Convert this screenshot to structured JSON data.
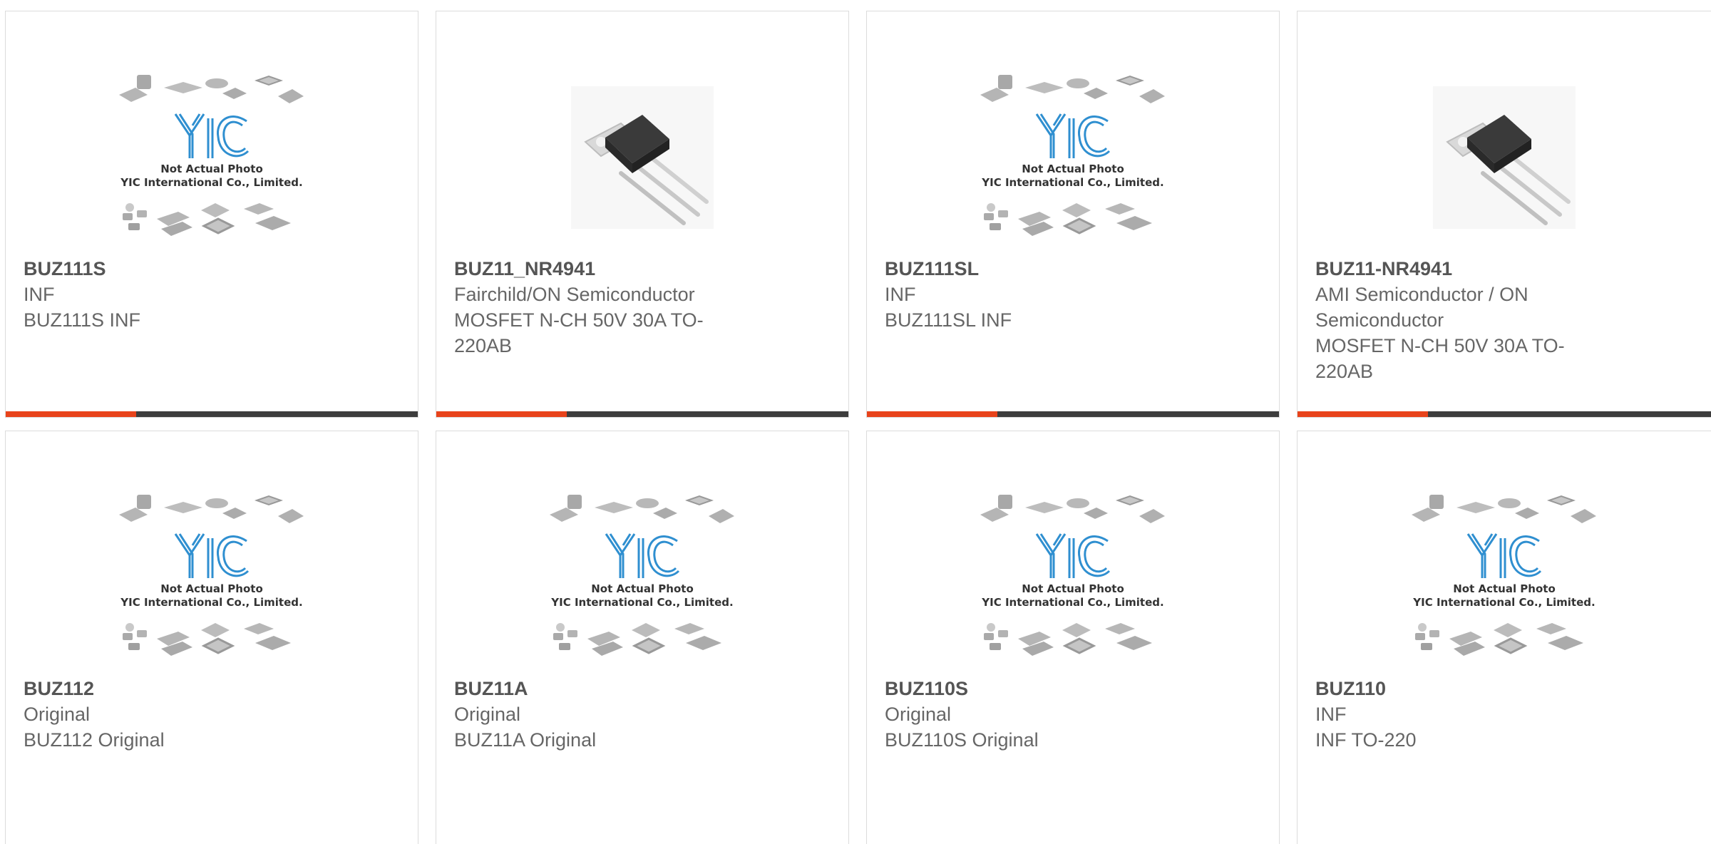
{
  "placeholder": {
    "line1": "Not Actual Photo",
    "line2": "YIC International Co., Limited."
  },
  "colors": {
    "accent": "#e8431b",
    "bar": "#3d3d3d",
    "logo": "#2f8fd0"
  },
  "products": [
    {
      "part": "BUZ111S",
      "lines": [
        "INF",
        "BUZ111S INF"
      ],
      "image": "placeholder"
    },
    {
      "part": "BUZ11_NR4941",
      "lines": [
        "Fairchild/ON Semiconductor",
        "MOSFET N-CH 50V 30A TO-",
        "220AB"
      ],
      "image": "to220"
    },
    {
      "part": "BUZ111SL",
      "lines": [
        "INF",
        "BUZ111SL INF"
      ],
      "image": "placeholder"
    },
    {
      "part": "BUZ11-NR4941",
      "lines": [
        "AMI Semiconductor / ON",
        "Semiconductor",
        "MOSFET N-CH 50V 30A TO-",
        "220AB"
      ],
      "image": "to220"
    },
    {
      "part": "BUZ112",
      "lines": [
        "Original",
        "BUZ112 Original"
      ],
      "image": "placeholder"
    },
    {
      "part": "BUZ11A",
      "lines": [
        "Original",
        "BUZ11A Original"
      ],
      "image": "placeholder"
    },
    {
      "part": "BUZ110S",
      "lines": [
        "Original",
        "BUZ110S Original"
      ],
      "image": "placeholder"
    },
    {
      "part": "BUZ110",
      "lines": [
        "INF",
        "INF TO-220"
      ],
      "image": "placeholder"
    }
  ]
}
